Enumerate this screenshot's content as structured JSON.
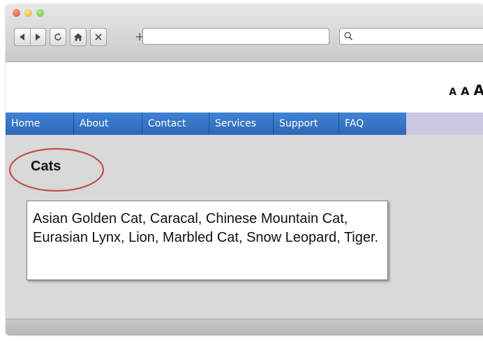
{
  "toolbar": {
    "new_tab_label": "+",
    "url_value": "",
    "search_value": ""
  },
  "font_sizer": {
    "small": "A",
    "medium": "A",
    "large": "A"
  },
  "nav": {
    "items": [
      {
        "label": "Home"
      },
      {
        "label": "About"
      },
      {
        "label": "Contact"
      },
      {
        "label": "Services"
      },
      {
        "label": "Support"
      },
      {
        "label": "FAQ"
      }
    ]
  },
  "main": {
    "heading": "Cats",
    "body": "Asian Golden Cat, Caracal, Chinese Mountain Cat, Eurasian Lynx, Lion, Marbled Cat, Snow Leopard, Tiger."
  },
  "colors": {
    "nav_blue": "#3a78c8",
    "nav_tail": "#ccc7e3",
    "circle_stroke": "#c0504d"
  }
}
